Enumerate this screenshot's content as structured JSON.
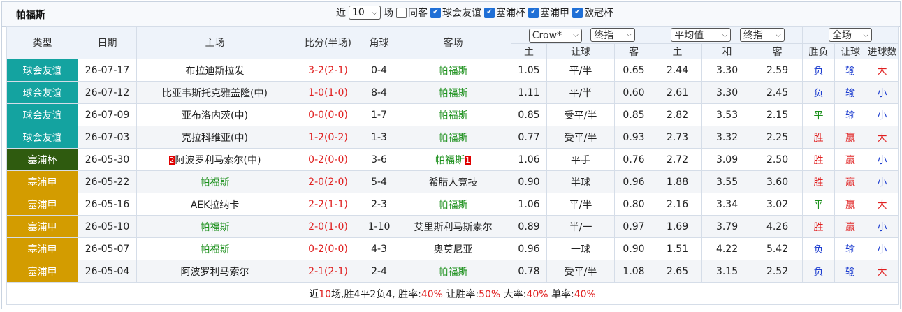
{
  "team_title": "帕福斯",
  "filters": {
    "prefix": "近",
    "count": "10",
    "unit": "场",
    "options": [
      {
        "label": "同客",
        "checked": false
      },
      {
        "label": "球会友谊",
        "checked": true
      },
      {
        "label": "塞浦杯",
        "checked": true
      },
      {
        "label": "塞浦甲",
        "checked": true
      },
      {
        "label": "欧冠杯",
        "checked": true
      }
    ]
  },
  "header": {
    "type": "类型",
    "date": "日期",
    "home": "主场",
    "score": "比分(半场)",
    "corner": "角球",
    "away": "客场",
    "company_select": "Crow*",
    "handicap_select": "终指",
    "avg_select": "平均值",
    "ou_select": "终指",
    "range_select": "全场",
    "sub": {
      "h_home": "主",
      "h_line": "让球",
      "h_away": "客",
      "o_home": "主",
      "o_draw": "和",
      "o_away": "客",
      "r_wdl": "胜负",
      "r_hcp": "让球",
      "r_goals": "进球数"
    }
  },
  "colors": {
    "friendly": "#14a3a0",
    "cup": "#2f5b0f",
    "league": "#d39c00"
  },
  "rows": [
    {
      "type": "球会友谊",
      "kind": "friendly",
      "date": "26-07-17",
      "home": "布拉迪斯拉发",
      "home_red": "",
      "home_green": false,
      "score": "3-2(2-1)",
      "corner": "0-4",
      "away": "帕福斯",
      "away_red": "",
      "away_green": true,
      "h_home": "1.05",
      "h_line": "平/半",
      "h_away": "0.65",
      "o_home": "2.44",
      "o_draw": "3.30",
      "o_away": "2.59",
      "wdl": "负",
      "hcp": "输",
      "goals": "大"
    },
    {
      "type": "球会友谊",
      "kind": "friendly",
      "date": "26-07-12",
      "home": "比亚韦斯托克雅盖隆(中)",
      "home_red": "",
      "home_green": false,
      "score": "1-0(1-0)",
      "corner": "8-4",
      "away": "帕福斯",
      "away_red": "",
      "away_green": true,
      "h_home": "1.11",
      "h_line": "平/半",
      "h_away": "0.60",
      "o_home": "2.61",
      "o_draw": "3.30",
      "o_away": "2.45",
      "wdl": "负",
      "hcp": "输",
      "goals": "小"
    },
    {
      "type": "球会友谊",
      "kind": "friendly",
      "date": "26-07-09",
      "home": "亚布洛内茨(中)",
      "home_red": "",
      "home_green": false,
      "score": "0-0(0-0)",
      "corner": "1-7",
      "away": "帕福斯",
      "away_red": "",
      "away_green": true,
      "h_home": "0.85",
      "h_line": "受平/半",
      "h_away": "0.85",
      "o_home": "2.82",
      "o_draw": "3.53",
      "o_away": "2.15",
      "wdl": "平",
      "hcp": "输",
      "goals": "小"
    },
    {
      "type": "球会友谊",
      "kind": "friendly",
      "date": "26-07-03",
      "home": "克拉科维亚(中)",
      "home_red": "",
      "home_green": false,
      "score": "1-2(0-2)",
      "corner": "1-3",
      "away": "帕福斯",
      "away_red": "",
      "away_green": true,
      "h_home": "0.77",
      "h_line": "受平/半",
      "h_away": "0.93",
      "o_home": "2.73",
      "o_draw": "3.32",
      "o_away": "2.25",
      "wdl": "胜",
      "hcp": "赢",
      "goals": "大"
    },
    {
      "type": "塞浦杯",
      "kind": "cup",
      "date": "26-05-30",
      "home": "阿波罗利马索尔(中)",
      "home_red": "2",
      "home_green": false,
      "score": "0-2(0-0)",
      "corner": "3-6",
      "away": "帕福斯",
      "away_red": "1",
      "away_green": true,
      "h_home": "1.06",
      "h_line": "平手",
      "h_away": "0.76",
      "o_home": "2.72",
      "o_draw": "3.09",
      "o_away": "2.50",
      "wdl": "胜",
      "hcp": "赢",
      "goals": "小"
    },
    {
      "type": "塞浦甲",
      "kind": "league",
      "date": "26-05-22",
      "home": "帕福斯",
      "home_red": "",
      "home_green": true,
      "score": "2-0(2-0)",
      "corner": "5-4",
      "away": "希腊人竞技",
      "away_red": "",
      "away_green": false,
      "h_home": "0.90",
      "h_line": "半球",
      "h_away": "0.96",
      "o_home": "1.88",
      "o_draw": "3.55",
      "o_away": "3.60",
      "wdl": "胜",
      "hcp": "赢",
      "goals": "小"
    },
    {
      "type": "塞浦甲",
      "kind": "league",
      "date": "26-05-16",
      "home": "AEK拉纳卡",
      "home_red": "",
      "home_green": false,
      "score": "2-2(1-1)",
      "corner": "2-3",
      "away": "帕福斯",
      "away_red": "",
      "away_green": true,
      "h_home": "1.06",
      "h_line": "平/半",
      "h_away": "0.80",
      "o_home": "2.16",
      "o_draw": "3.34",
      "o_away": "3.02",
      "wdl": "平",
      "hcp": "赢",
      "goals": "大"
    },
    {
      "type": "塞浦甲",
      "kind": "league",
      "date": "26-05-10",
      "home": "帕福斯",
      "home_red": "",
      "home_green": true,
      "score": "2-0(1-0)",
      "corner": "1-10",
      "away": "艾里斯利马斯素尔",
      "away_red": "",
      "away_green": false,
      "h_home": "0.89",
      "h_line": "半/一",
      "h_away": "0.97",
      "o_home": "1.69",
      "o_draw": "3.79",
      "o_away": "4.26",
      "wdl": "胜",
      "hcp": "赢",
      "goals": "小"
    },
    {
      "type": "塞浦甲",
      "kind": "league",
      "date": "26-05-07",
      "home": "帕福斯",
      "home_red": "",
      "home_green": true,
      "score": "0-2(0-0)",
      "corner": "4-3",
      "away": "奥莫尼亚",
      "away_red": "",
      "away_green": false,
      "h_home": "0.96",
      "h_line": "一球",
      "h_away": "0.90",
      "o_home": "1.51",
      "o_draw": "4.22",
      "o_away": "5.42",
      "wdl": "负",
      "hcp": "输",
      "goals": "小"
    },
    {
      "type": "塞浦甲",
      "kind": "league",
      "date": "26-05-04",
      "home": "阿波罗利马索尔",
      "home_red": "",
      "home_green": false,
      "score": "2-1(2-1)",
      "corner": "2-4",
      "away": "帕福斯",
      "away_red": "",
      "away_green": true,
      "h_home": "0.78",
      "h_line": "受平/半",
      "h_away": "1.08",
      "o_home": "2.65",
      "o_draw": "3.15",
      "o_away": "2.52",
      "wdl": "负",
      "hcp": "输",
      "goals": "大"
    }
  ],
  "summary": [
    {
      "t": "近",
      "red": false
    },
    {
      "t": "10",
      "red": true
    },
    {
      "t": "场,胜4平2负4, 胜率:",
      "red": false
    },
    {
      "t": "40%",
      "red": true
    },
    {
      "t": " 让胜率:",
      "red": false
    },
    {
      "t": "50%",
      "red": true
    },
    {
      "t": " 大率:",
      "red": false
    },
    {
      "t": "40%",
      "red": true
    },
    {
      "t": " 单率:",
      "red": false
    },
    {
      "t": "40%",
      "red": true
    }
  ]
}
